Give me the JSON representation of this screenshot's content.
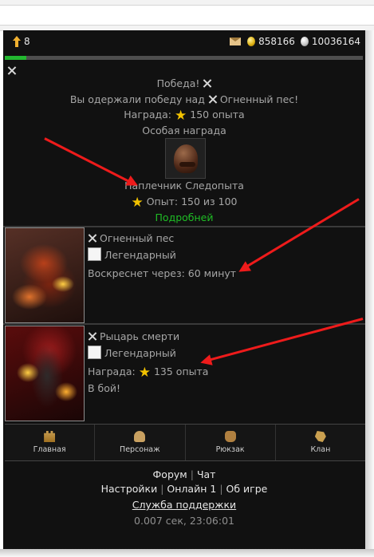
{
  "player": {
    "level": "8",
    "gold": "858166",
    "silver": "10036164",
    "xp_progress": 0.06
  },
  "battle": {
    "victory": "Победа!",
    "won_over_prefix": "Вы одержали победу над",
    "enemy": "Огненный пес!",
    "reward_label": "Наградa:",
    "reward_xp": "150 опыта",
    "special_reward": "Особая награда",
    "item_name": "Наплечник Следопыта",
    "item_xp": "Опыт: 150 из 100",
    "details_link": "Подробней"
  },
  "mobs": [
    {
      "name": "Огненный пес",
      "rank": "Легендарный",
      "status": "Воскреснет через: 60 минут"
    },
    {
      "name": "Рыцарь смерти",
      "rank": "Легендарный",
      "reward_label": "Награда:",
      "reward_xp": "135 опыта",
      "action": "В бой!"
    }
  ],
  "nav": [
    {
      "label": "Главная",
      "icon": "castle-icon"
    },
    {
      "label": "Персонаж",
      "icon": "character-icon"
    },
    {
      "label": "Рюкзак",
      "icon": "backpack-icon"
    },
    {
      "label": "Клан",
      "icon": "lion-icon"
    }
  ],
  "footer": {
    "forum": "Форум",
    "chat": "Чат",
    "settings": "Настройки",
    "online": "Онлайн 1",
    "about": "Об игре",
    "support": "Служба поддержки",
    "time": "0.007 сек, 23:06:01"
  },
  "colors": {
    "background": "#111111",
    "accent_green": "#1fbd25",
    "star_gold": "#f2c200",
    "annotation_red": "#ee1b1b"
  }
}
